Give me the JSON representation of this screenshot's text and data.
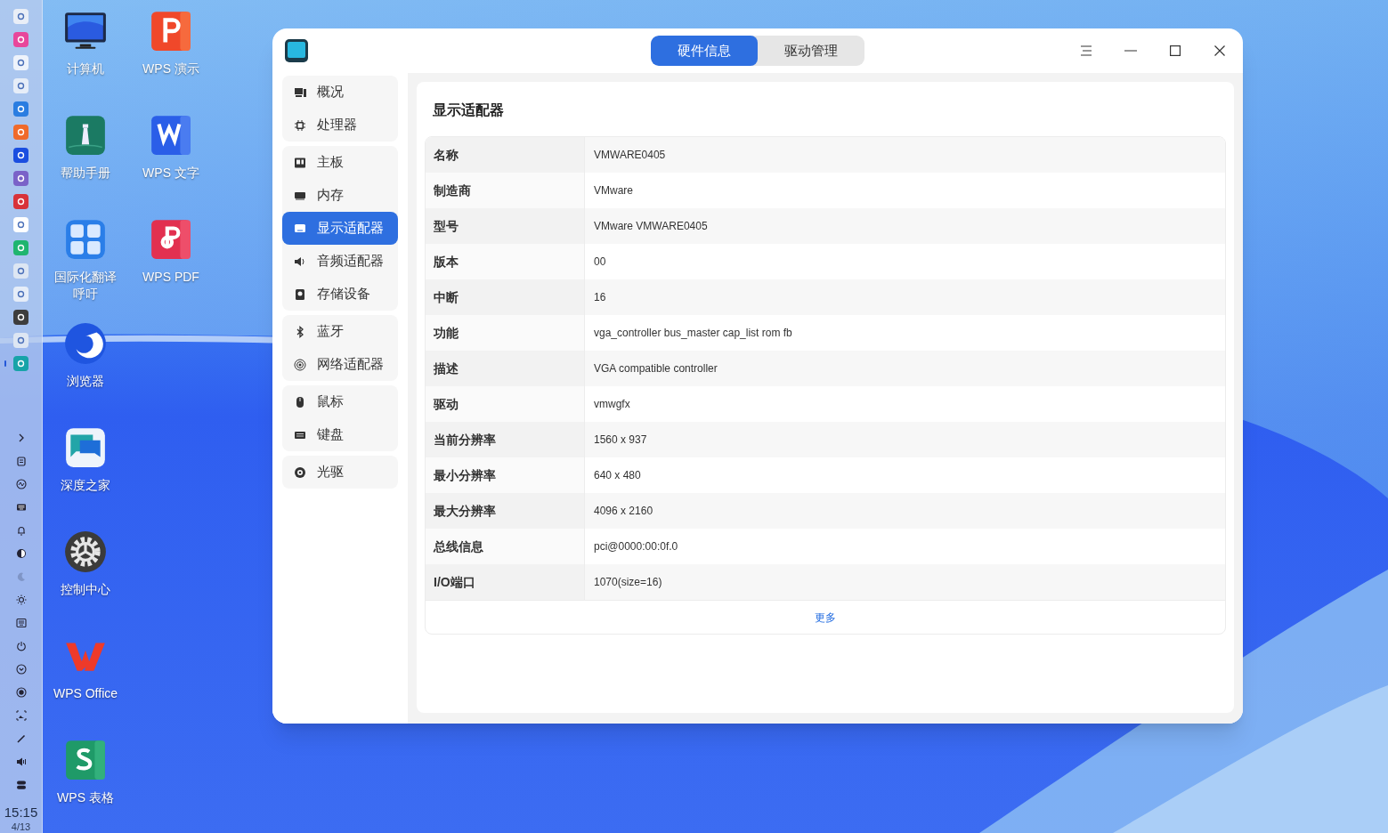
{
  "dock": {
    "apps": [
      {
        "running": false
      },
      {
        "running": false
      },
      {
        "running": false
      },
      {
        "running": false
      },
      {
        "running": false
      },
      {
        "running": false
      },
      {
        "running": false
      },
      {
        "running": false
      },
      {
        "running": false
      },
      {
        "running": false
      },
      {
        "running": false
      },
      {
        "running": false
      },
      {
        "running": false
      },
      {
        "running": false
      },
      {
        "running": false
      },
      {
        "running": true
      }
    ],
    "clock": {
      "time": "15:15",
      "date": "4/13"
    }
  },
  "desktop_icons": [
    {
      "label": "计算机"
    },
    {
      "label": "帮助手册"
    },
    {
      "label": "国际化翻译呼吁"
    },
    {
      "label": "浏览器"
    },
    {
      "label": "深度之家"
    },
    {
      "label": "控制中心"
    },
    {
      "label": "WPS Office"
    },
    {
      "label": "WPS 表格"
    },
    {
      "label": "WPS 演示"
    },
    {
      "label": "WPS 文字"
    },
    {
      "label": "WPS PDF"
    }
  ],
  "window": {
    "tabs": [
      {
        "label": "硬件信息",
        "selected": true
      },
      {
        "label": "驱动管理",
        "selected": false
      }
    ],
    "sidebar": {
      "groups": [
        {
          "items": [
            {
              "label": "概况",
              "selected": false
            },
            {
              "label": "处理器",
              "selected": false
            }
          ]
        },
        {
          "items": [
            {
              "label": "主板",
              "selected": false
            },
            {
              "label": "内存",
              "selected": false
            },
            {
              "label": "显示适配器",
              "selected": true
            },
            {
              "label": "音频适配器",
              "selected": false
            },
            {
              "label": "存储设备",
              "selected": false
            }
          ]
        },
        {
          "items": [
            {
              "label": "蓝牙",
              "selected": false
            },
            {
              "label": "网络适配器",
              "selected": false
            }
          ]
        },
        {
          "items": [
            {
              "label": "鼠标",
              "selected": false
            },
            {
              "label": "键盘",
              "selected": false
            }
          ]
        },
        {
          "items": [
            {
              "label": "光驱",
              "selected": false
            }
          ]
        }
      ]
    },
    "content": {
      "title": "显示适配器",
      "rows": [
        {
          "label": "名称",
          "value": "VMWARE0405"
        },
        {
          "label": "制造商",
          "value": "VMware"
        },
        {
          "label": "型号",
          "value": "VMware VMWARE0405"
        },
        {
          "label": "版本",
          "value": "00"
        },
        {
          "label": "中断",
          "value": "16"
        },
        {
          "label": "功能",
          "value": "vga_controller bus_master cap_list rom fb"
        },
        {
          "label": "描述",
          "value": "VGA compatible controller"
        },
        {
          "label": "驱动",
          "value": "vmwgfx"
        },
        {
          "label": "当前分辨率",
          "value": "1560 x 937"
        },
        {
          "label": "最小分辨率",
          "value": "640 x 480"
        },
        {
          "label": "最大分辨率",
          "value": "4096 x 2160"
        },
        {
          "label": "总线信息",
          "value": "pci@0000:00:0f.0"
        },
        {
          "label": "I/O端口",
          "value": "1070(size=16)"
        }
      ],
      "more_link": "更多"
    }
  }
}
